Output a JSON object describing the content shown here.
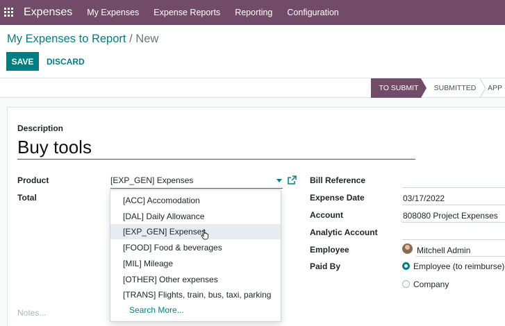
{
  "navbar": {
    "brand": "Expenses",
    "items": [
      "My Expenses",
      "Expense Reports",
      "Reporting",
      "Configuration"
    ]
  },
  "breadcrumb": {
    "parent": "My Expenses to Report",
    "separator": "/",
    "current": "New"
  },
  "toolbar": {
    "save_label": "SAVE",
    "discard_label": "DISCARD"
  },
  "statusbar": {
    "stages": [
      "TO SUBMIT",
      "SUBMITTED",
      "APP"
    ],
    "active": "TO SUBMIT"
  },
  "form": {
    "description_label": "Description",
    "description_value": "Buy tools",
    "product_label": "Product",
    "product_value": "[EXP_GEN] Expenses",
    "total_label": "Total",
    "bill_reference_label": "Bill Reference",
    "expense_date_label": "Expense Date",
    "expense_date_value": "03/17/2022",
    "account_label": "Account",
    "account_value": "808080 Project Expenses",
    "analytic_account_label": "Analytic Account",
    "employee_label": "Employee",
    "employee_value": "Mitchell Admin",
    "paid_by_label": "Paid By",
    "paid_by_options": [
      "Employee (to reimburse)",
      "Company"
    ],
    "paid_by_selected": "Employee (to reimburse)",
    "notes_placeholder": "Notes..."
  },
  "dropdown": {
    "items": [
      "[ACC] Accomodation",
      "[DAL] Daily Allowance",
      "[EXP_GEN] Expenses",
      "[FOOD] Food & beverages",
      "[MIL] Mileage",
      "[OTHER] Other expenses",
      "[TRANS] Flights, train, bus, taxi, parking"
    ],
    "search_more": "Search More...",
    "hovered": "[EXP_GEN] Expenses"
  },
  "colors": {
    "brand": "#714b67",
    "accent": "#017e84"
  }
}
